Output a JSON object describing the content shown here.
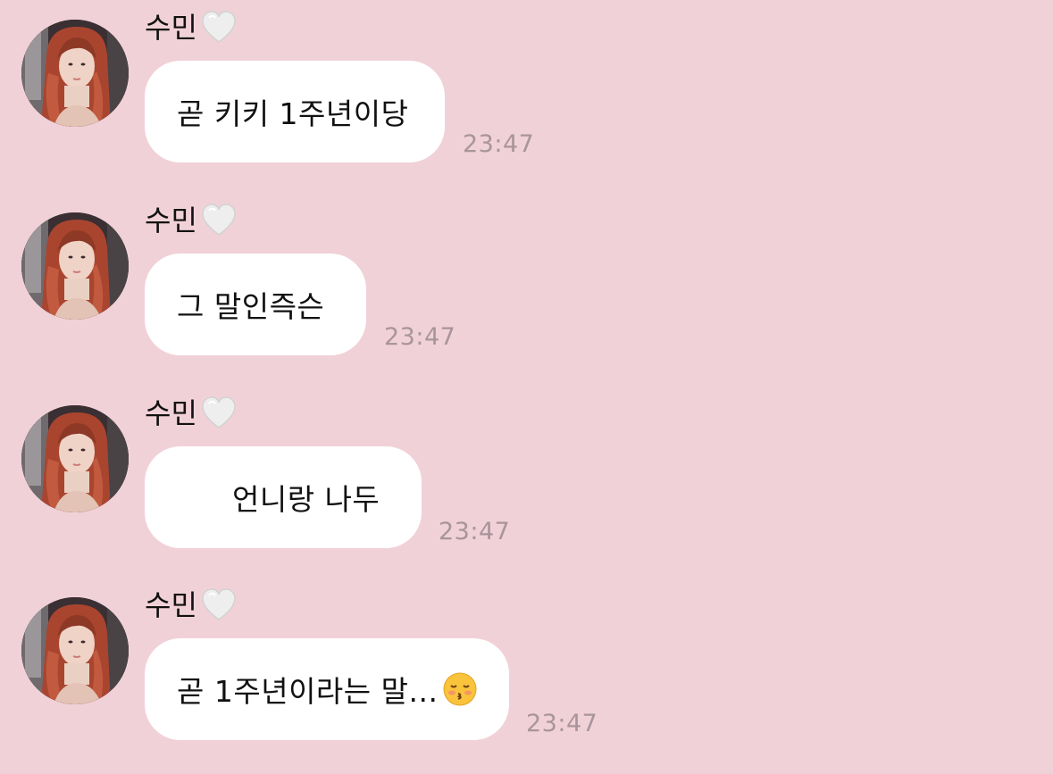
{
  "chat": {
    "background_color": "#f1d1d8",
    "bubble_color": "#ffffff",
    "time_color": "#a8959b",
    "messages": [
      {
        "sender": "수민",
        "sender_icon": "white-heart-icon",
        "text": "곧 키키 1주년이당",
        "time": "23:47"
      },
      {
        "sender": "수민",
        "sender_icon": "white-heart-icon",
        "text": "그 말인즉슨",
        "time": "23:47"
      },
      {
        "sender": "수민",
        "sender_icon": "white-heart-icon",
        "text": "언니랑 나두",
        "time": "23:47"
      },
      {
        "sender": "수민",
        "sender_icon": "white-heart-icon",
        "text": "곧 1주년이라는 말...",
        "emoji": "kissing-face-closed-eyes-icon",
        "time": "23:47"
      }
    ]
  }
}
